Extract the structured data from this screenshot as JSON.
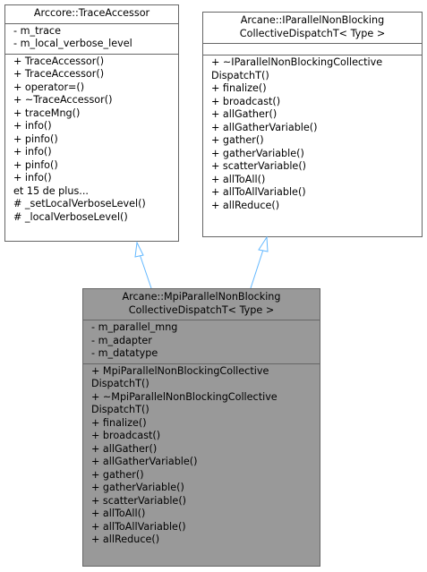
{
  "nodes": {
    "trace_accessor": {
      "title": [
        "Arccore::TraceAccessor"
      ],
      "attributes": [
        "- m_trace",
        "- m_local_verbose_level"
      ],
      "methods": [
        "+ TraceAccessor()",
        "+ TraceAccessor()",
        "+ operator=()",
        "+ ~TraceAccessor()",
        "+ traceMng()",
        "+ info()",
        "+ pinfo()",
        "+ info()",
        "+ pinfo()",
        "+ info()",
        "et 15 de plus...",
        "# _setLocalVerboseLevel()",
        "# _localVerboseLevel()"
      ]
    },
    "iparallel": {
      "title": [
        "Arcane::IParallelNonBlocking",
        "CollectiveDispatchT< Type >"
      ],
      "attributes": [],
      "methods": [
        "+ ~IParallelNonBlockingCollective",
        "DispatchT()",
        "+ finalize()",
        "+ broadcast()",
        "+ allGather()",
        "+ allGatherVariable()",
        "+ gather()",
        "+ gatherVariable()",
        "+ scatterVariable()",
        "+ allToAll()",
        "+ allToAllVariable()",
        "+ allReduce()"
      ]
    },
    "mpi_parallel": {
      "title": [
        "Arcane::MpiParallelNonBlocking",
        "CollectiveDispatchT< Type >"
      ],
      "attributes": [
        "- m_parallel_mng",
        "- m_adapter",
        "- m_datatype"
      ],
      "methods": [
        "+ MpiParallelNonBlockingCollective",
        "DispatchT()",
        "+ ~MpiParallelNonBlockingCollective",
        "DispatchT()",
        "+ finalize()",
        "+ broadcast()",
        "+ allGather()",
        "+ allGatherVariable()",
        "+ gather()",
        "+ gatherVariable()",
        "+ scatterVariable()",
        "+ allToAll()",
        "+ allToAllVariable()",
        "+ allReduce()"
      ]
    }
  },
  "colors": {
    "border": "#666666",
    "derived_fill": "#999999",
    "base_fill": "#ffffff",
    "arrow": "#63b8ff"
  }
}
